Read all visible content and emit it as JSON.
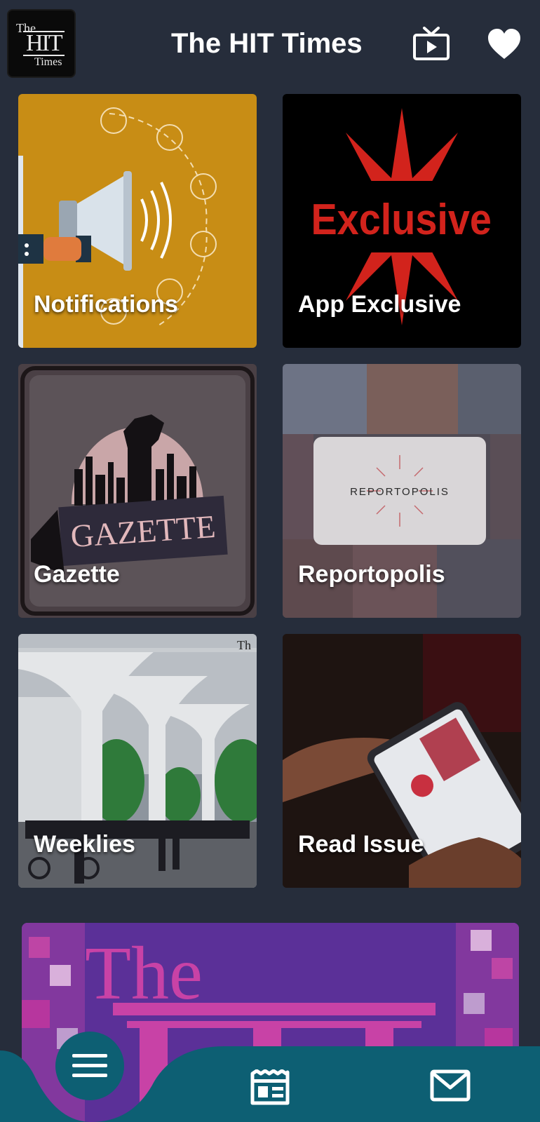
{
  "header": {
    "logo": {
      "line1": "The",
      "line2": "HIT",
      "line3": "Times"
    },
    "title": "The HIT Times",
    "icons": [
      "tv-icon",
      "heart-icon"
    ]
  },
  "tiles": [
    {
      "label": "Notifications",
      "art_text": ""
    },
    {
      "label": "App Exclusive",
      "art_text": "Exclusive"
    },
    {
      "label": "Gazette",
      "art_text": "GAZETTE"
    },
    {
      "label": "Reportopolis",
      "art_text": "REPORTOPOLIS"
    },
    {
      "label": "Weeklies",
      "art_text": "Th"
    },
    {
      "label": "Read Issue",
      "art_text": ""
    }
  ],
  "banner": {
    "text": "The"
  },
  "bottom_nav": {
    "icons": [
      "menu-icon",
      "newspaper-icon",
      "mail-icon"
    ]
  },
  "colors": {
    "background": "#262d3b",
    "nav": "#0d5f73",
    "notifications_tile": "#c88d15",
    "exclusive_red": "#d2231c"
  }
}
